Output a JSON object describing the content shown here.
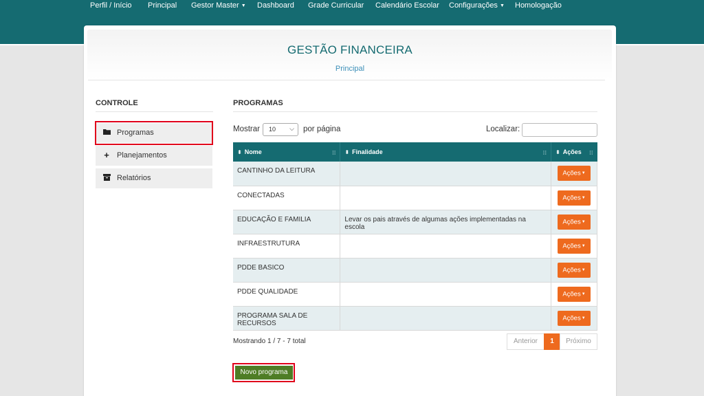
{
  "nav": [
    "Perfil / Início",
    "Principal",
    "Gestor Master",
    "Dashboard",
    "Grade Curricular",
    "Calendário Escolar",
    "Configurações",
    "Homologação"
  ],
  "header": {
    "title": "GESTÃO FINANCEIRA",
    "subtitle": "Principal"
  },
  "sidebar": {
    "title": "CONTROLE",
    "items": [
      {
        "label": "Programas",
        "icon": "folder-icon"
      },
      {
        "label": "Planejamentos",
        "icon": "plus-icon"
      },
      {
        "label": "Relatórios",
        "icon": "archive-icon"
      }
    ]
  },
  "main": {
    "title": "PROGRAMAS",
    "show_label": "Mostrar",
    "page_size": "10",
    "per_page_label": "por página",
    "search_label": "Localizar:",
    "columns": [
      "Nome",
      "Finalidade",
      "Ações"
    ],
    "rows": [
      {
        "nome": "CANTINHO DA LEITURA",
        "finalidade": ""
      },
      {
        "nome": "CONECTADAS",
        "finalidade": ""
      },
      {
        "nome": "EDUCAÇÃO E FAMILIA",
        "finalidade": "Levar os pais através de algumas ações implementadas na escola"
      },
      {
        "nome": "INFRAESTRUTURA",
        "finalidade": ""
      },
      {
        "nome": "PDDE BASICO",
        "finalidade": ""
      },
      {
        "nome": "PDDE QUALIDADE",
        "finalidade": ""
      },
      {
        "nome": "PROGRAMA SALA DE RECURSOS",
        "finalidade": ""
      }
    ],
    "action_label": "Ações",
    "info": "Mostrando 1 / 7 - 7 total",
    "pager": {
      "prev": "Anterior",
      "current": "1",
      "next": "Próximo"
    },
    "new_button": "Novo programa"
  },
  "colors": {
    "primary": "#156b71",
    "accent": "#ee6a1e",
    "new_button": "#4e7d25",
    "highlight": "#e0001a"
  }
}
